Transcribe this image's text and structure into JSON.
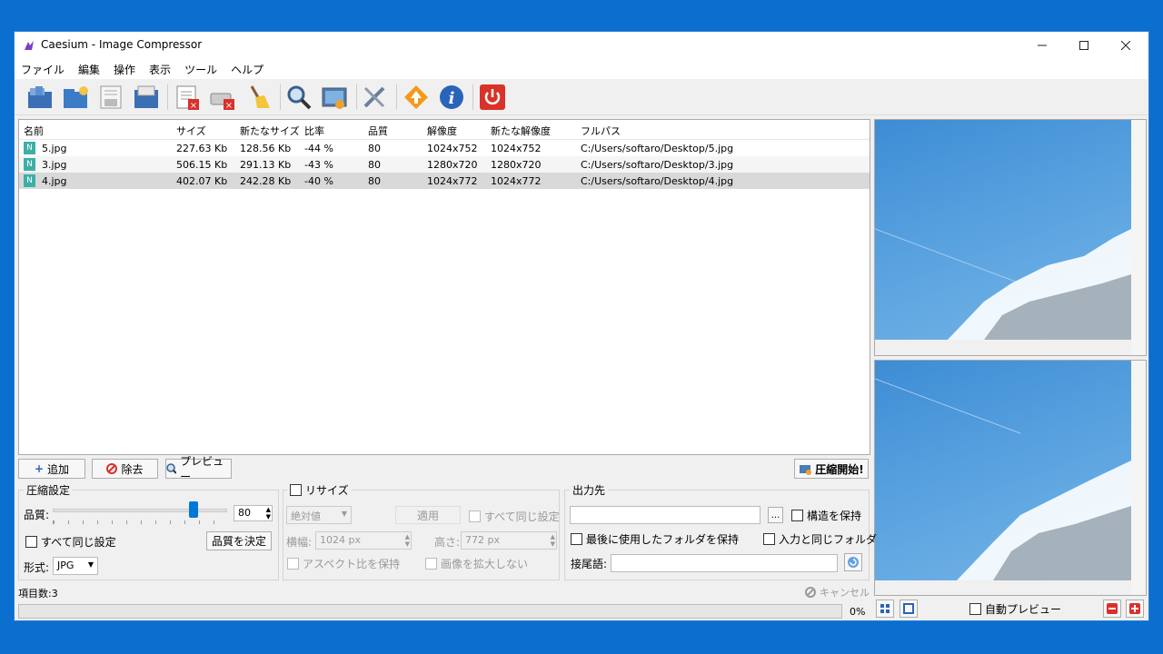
{
  "window": {
    "title": "Caesium - Image Compressor"
  },
  "menu": [
    "ファイル",
    "編集",
    "操作",
    "表示",
    "ツール",
    "ヘルプ"
  ],
  "toolbar_icons": [
    "open-file-icon",
    "open-folder-icon",
    "save-icon",
    "save-as-icon",
    "remove-item-icon",
    "clear-list-icon",
    "clean-icon",
    "preview-search-icon",
    "image-preview-icon",
    "settings-icon",
    "update-icon",
    "info-icon",
    "exit-icon"
  ],
  "list": {
    "columns": [
      "名前",
      "サイズ",
      "新たなサイズ",
      "比率",
      "品質",
      "解像度",
      "新たな解像度",
      "フルパス"
    ],
    "rows": [
      [
        "5.jpg",
        "227.63 Kb",
        "128.56 Kb",
        "-44 %",
        "80",
        "1024x752",
        "1024x752",
        "C:/Users/softaro/Desktop/5.jpg"
      ],
      [
        "3.jpg",
        "506.15 Kb",
        "291.13 Kb",
        "-43 %",
        "80",
        "1280x720",
        "1280x720",
        "C:/Users/softaro/Desktop/3.jpg"
      ],
      [
        "4.jpg",
        "402.07 Kb",
        "242.28 Kb",
        "-40 %",
        "80",
        "1024x772",
        "1024x772",
        "C:/Users/softaro/Desktop/4.jpg"
      ]
    ],
    "file_badge": "N"
  },
  "buttons": {
    "add": "追加",
    "remove": "除去",
    "preview": "プレビュー",
    "compress": "圧縮開始!"
  },
  "compression": {
    "title": "圧縮設定",
    "quality_label": "品質:",
    "quality_value": "80",
    "quality_level": 0.8,
    "same_all": "すべて同じ設定",
    "set_quality": "品質を決定",
    "format_label": "形式:",
    "format_value": "JPG"
  },
  "resize": {
    "title": "リサイズ",
    "mode": "絶対値",
    "apply": "適用",
    "same_all": "すべて同じ設定",
    "width_label": "横幅:",
    "width_value": "1024 px",
    "height_label": "高さ:",
    "height_value": "772 px",
    "keep_aspect": "アスペクト比を保持",
    "no_enlarge": "画像を拡大しない"
  },
  "output": {
    "title": "出力先",
    "path": "",
    "browse": "...",
    "keep_structure": "構造を保持",
    "keep_last_folder": "最後に使用したフォルダを保持",
    "same_as_input": "入力と同じフォルダ",
    "suffix_label": "接尾語:",
    "suffix_value": ""
  },
  "status": {
    "items": "項目数:3",
    "cancel": "キャンセル",
    "progress_text": "0%",
    "progress_value": 0
  },
  "preview_panel": {
    "auto_preview": "自動プレビュー"
  }
}
